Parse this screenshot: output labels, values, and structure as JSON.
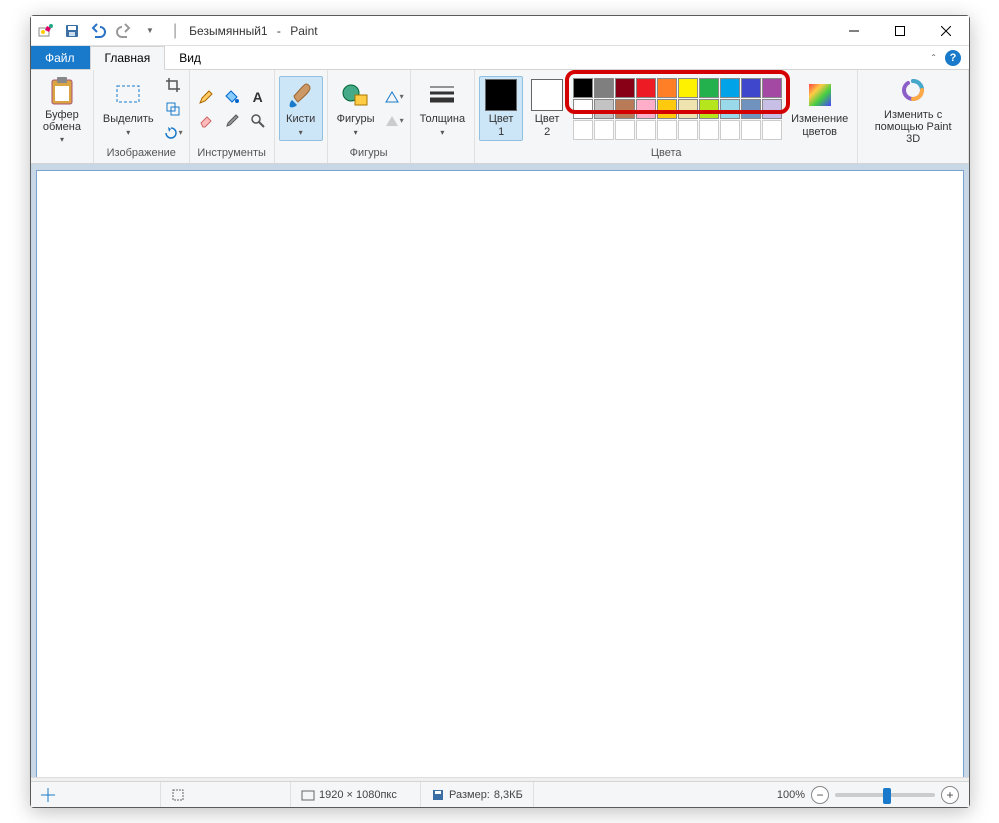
{
  "title": {
    "document": "Безымянный1",
    "app": "Paint"
  },
  "tabs": {
    "file": "Файл",
    "home": "Главная",
    "view": "Вид"
  },
  "ribbon": {
    "clipboard": {
      "label": "Буфер",
      "sublabel": "обмена",
      "group": ""
    },
    "image": {
      "select": "Выделить",
      "group": "Изображение"
    },
    "tools": {
      "group": "Инструменты"
    },
    "brushes": {
      "label": "Кисти"
    },
    "shapes": {
      "label": "Фигуры",
      "group": "Фигуры"
    },
    "size": {
      "label": "Толщина"
    },
    "color1": {
      "label": "Цвет",
      "num": "1",
      "value": "#000000"
    },
    "color2": {
      "label": "Цвет",
      "num": "2",
      "value": "#ffffff"
    },
    "colors_group": "Цвета",
    "edit_colors": {
      "l1": "Изменение",
      "l2": "цветов"
    },
    "paint3d": {
      "l1": "Изменить с",
      "l2": "помощью Paint 3D"
    }
  },
  "palette": {
    "row1": [
      "#000000",
      "#7f7f7f",
      "#880015",
      "#ed1c24",
      "#ff7f27",
      "#fff200",
      "#22b14c",
      "#00a2e8",
      "#3f48cc",
      "#a349a4"
    ],
    "row2": [
      "#ffffff",
      "#c3c3c3",
      "#b97a57",
      "#ffaec9",
      "#ffc90e",
      "#efe4b0",
      "#b5e61d",
      "#99d9ea",
      "#7092be",
      "#c8bfe7"
    ]
  },
  "status": {
    "dims": "1920 × 1080пкс",
    "size_label": "Размер:",
    "size_value": "8,3КБ",
    "zoom": "100%"
  }
}
